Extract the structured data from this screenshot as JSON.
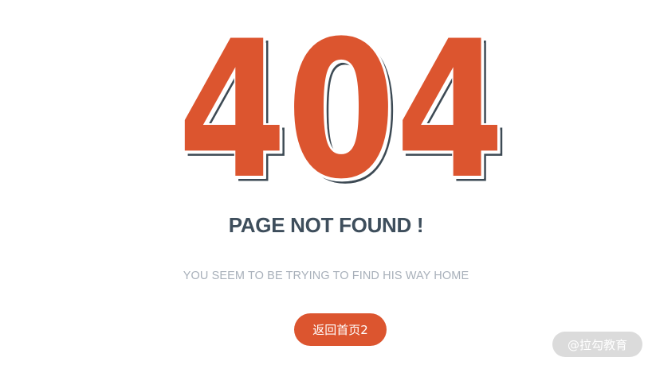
{
  "error": {
    "code": "404",
    "fill_color": "#dc552f",
    "outline_color": "#3d4a54"
  },
  "title": "PAGE NOT FOUND !",
  "subtitle": "YOU SEEM TO BE TRYING TO FIND HIS WAY HOME",
  "home_button": {
    "label": "返回首页2",
    "color": "#dc552f"
  },
  "watermark": "@拉勾教育"
}
